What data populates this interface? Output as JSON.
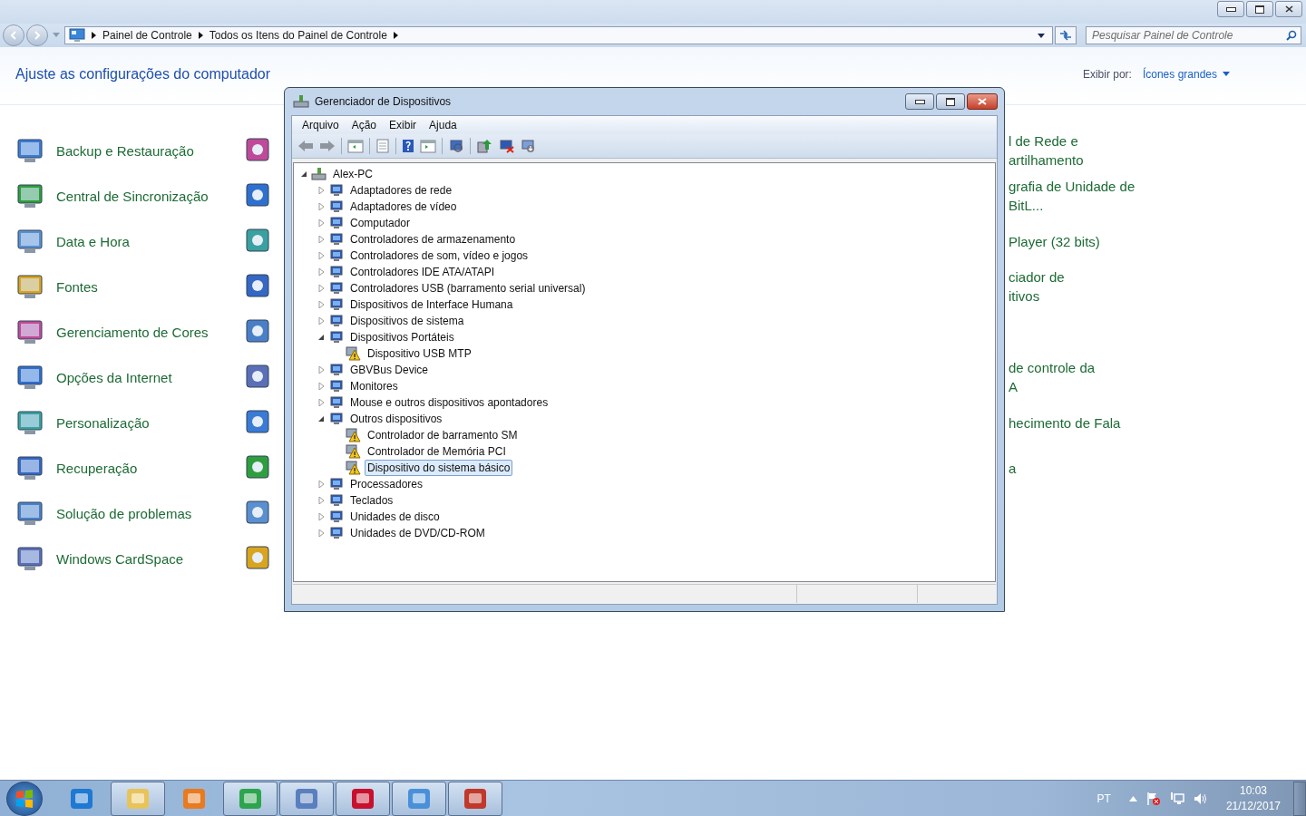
{
  "explorer": {
    "breadcrumb": [
      "Painel de Controle",
      "Todos os Itens do Painel de Controle"
    ],
    "search": {
      "placeholder": "Pesquisar Painel de Controle"
    },
    "heading": "Ajuste as configurações do computador",
    "view_by": {
      "label": "Exibir por:",
      "value": "Ícones grandes"
    },
    "items": [
      {
        "label": "Backup e Restauração",
        "right_lines": [
          "l de Rede e",
          "artilhamento"
        ]
      },
      {
        "label": "Central de Sincronização",
        "right_lines": [
          "grafia de Unidade de",
          "BitL..."
        ]
      },
      {
        "label": "Data e Hora",
        "right_lines": [
          "Player (32 bits)"
        ]
      },
      {
        "label": "Fontes",
        "right_lines": [
          "ciador de",
          "itivos"
        ]
      },
      {
        "label": "Gerenciamento de Cores"
      },
      {
        "label": "Opções da Internet",
        "right_lines": [
          "de controle da",
          "A"
        ]
      },
      {
        "label": "Personalização",
        "right_lines": [
          "hecimento de Fala"
        ]
      },
      {
        "label": "Recuperação",
        "right_lines": [
          "a"
        ]
      },
      {
        "label": "Solução de problemas"
      },
      {
        "label": "Windows CardSpace"
      }
    ]
  },
  "device_manager": {
    "title": "Gerenciador de Dispositivos",
    "menu": [
      "Arquivo",
      "Ação",
      "Exibir",
      "Ajuda"
    ],
    "tree": {
      "label": "Alex-PC",
      "expanded": true,
      "selected": false,
      "children": [
        {
          "label": "Adaptadores de rede",
          "expanded": false,
          "selected": false
        },
        {
          "label": "Adaptadores de vídeo",
          "expanded": false,
          "selected": false
        },
        {
          "label": "Computador",
          "expanded": false,
          "selected": false
        },
        {
          "label": "Controladores de armazenamento",
          "expanded": false,
          "selected": false
        },
        {
          "label": "Controladores de som, vídeo e jogos",
          "expanded": false,
          "selected": false
        },
        {
          "label": "Controladores IDE ATA/ATAPI",
          "expanded": false,
          "selected": false
        },
        {
          "label": "Controladores USB (barramento serial universal)",
          "expanded": false,
          "selected": false
        },
        {
          "label": "Dispositivos de Interface Humana",
          "expanded": false,
          "selected": false
        },
        {
          "label": "Dispositivos de sistema",
          "expanded": false,
          "selected": false
        },
        {
          "label": "Dispositivos Portáteis",
          "expanded": true,
          "selected": false,
          "children": [
            {
              "label": "Dispositivo USB MTP",
              "selected": false,
              "warning": true
            }
          ]
        },
        {
          "label": "GBVBus Device",
          "expanded": false,
          "selected": false
        },
        {
          "label": "Monitores",
          "expanded": false,
          "selected": false
        },
        {
          "label": "Mouse e outros dispositivos apontadores",
          "expanded": false,
          "selected": false
        },
        {
          "label": "Outros dispositivos",
          "expanded": true,
          "selected": false,
          "children": [
            {
              "label": "Controlador de barramento SM",
              "selected": false,
              "warning": true
            },
            {
              "label": "Controlador de Memória PCI",
              "selected": false,
              "warning": true
            },
            {
              "label": "Dispositivo do sistema básico",
              "selected": true,
              "warning": true
            }
          ]
        },
        {
          "label": "Processadores",
          "expanded": false,
          "selected": false
        },
        {
          "label": "Teclados",
          "expanded": false,
          "selected": false
        },
        {
          "label": "Unidades de disco",
          "expanded": false,
          "selected": false
        },
        {
          "label": "Unidades de DVD/CD-ROM",
          "expanded": false,
          "selected": false
        }
      ]
    }
  },
  "taskbar": {
    "apps": [
      {
        "running": false
      },
      {
        "running": true
      },
      {
        "running": false
      },
      {
        "running": true
      },
      {
        "running": true
      },
      {
        "running": true
      },
      {
        "running": true
      },
      {
        "running": true
      }
    ],
    "language": "PT",
    "time": "10:03",
    "date": "21/12/2017"
  }
}
